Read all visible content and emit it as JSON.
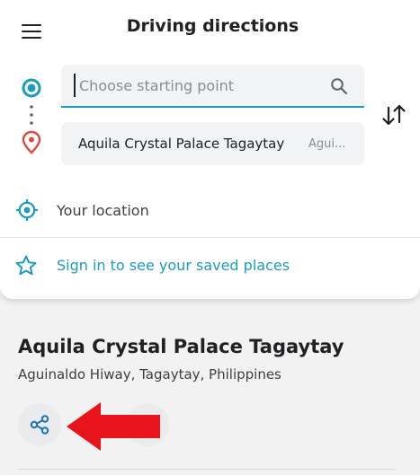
{
  "header": {
    "title": "Driving directions",
    "menu_icon": "hamburger-menu-icon"
  },
  "route": {
    "origin": {
      "value": "",
      "placeholder": "Choose starting point",
      "icon": "origin-circle-icon"
    },
    "destination": {
      "name": "Aquila Crystal Palace Tagaytay",
      "secondary": "Agui..."
    },
    "swap_icon": "swap-vertical-icon"
  },
  "suggestions": [
    {
      "label": "Your location",
      "icon": "crosshair-location-icon"
    },
    {
      "label": "Sign in to see your saved places",
      "icon": "star-outline-icon"
    }
  ],
  "place": {
    "title": "Aquila Crystal Palace Tagaytay",
    "address": "Aguinaldo Hiway, Tagaytay, Philippines",
    "share_icon": "share-icon"
  },
  "colors": {
    "accent": "#1a9bc0",
    "destination_pin": "#e24a3b",
    "annotation_arrow": "#e8141c",
    "panel_background": "#ffffff",
    "page_background": "#f2f2f2",
    "input_background": "#f1f3f4"
  }
}
